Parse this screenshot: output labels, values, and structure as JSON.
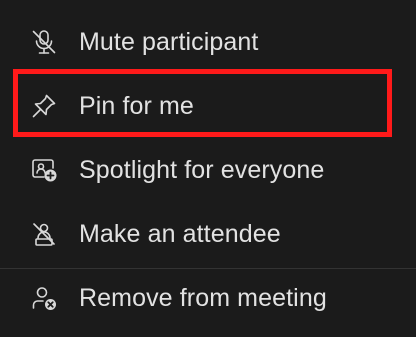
{
  "menu": {
    "items": [
      {
        "label": "Mute participant",
        "icon": "mic-off-icon"
      },
      {
        "label": "Pin for me",
        "icon": "pin-icon"
      },
      {
        "label": "Spotlight for everyone",
        "icon": "spotlight-icon"
      },
      {
        "label": "Make an attendee",
        "icon": "make-attendee-icon"
      },
      {
        "label": "Remove from meeting",
        "icon": "remove-person-icon"
      }
    ]
  },
  "colors": {
    "background": "#1b1b1b",
    "text": "#e2e2e2",
    "highlight": "#ff1a1a"
  }
}
